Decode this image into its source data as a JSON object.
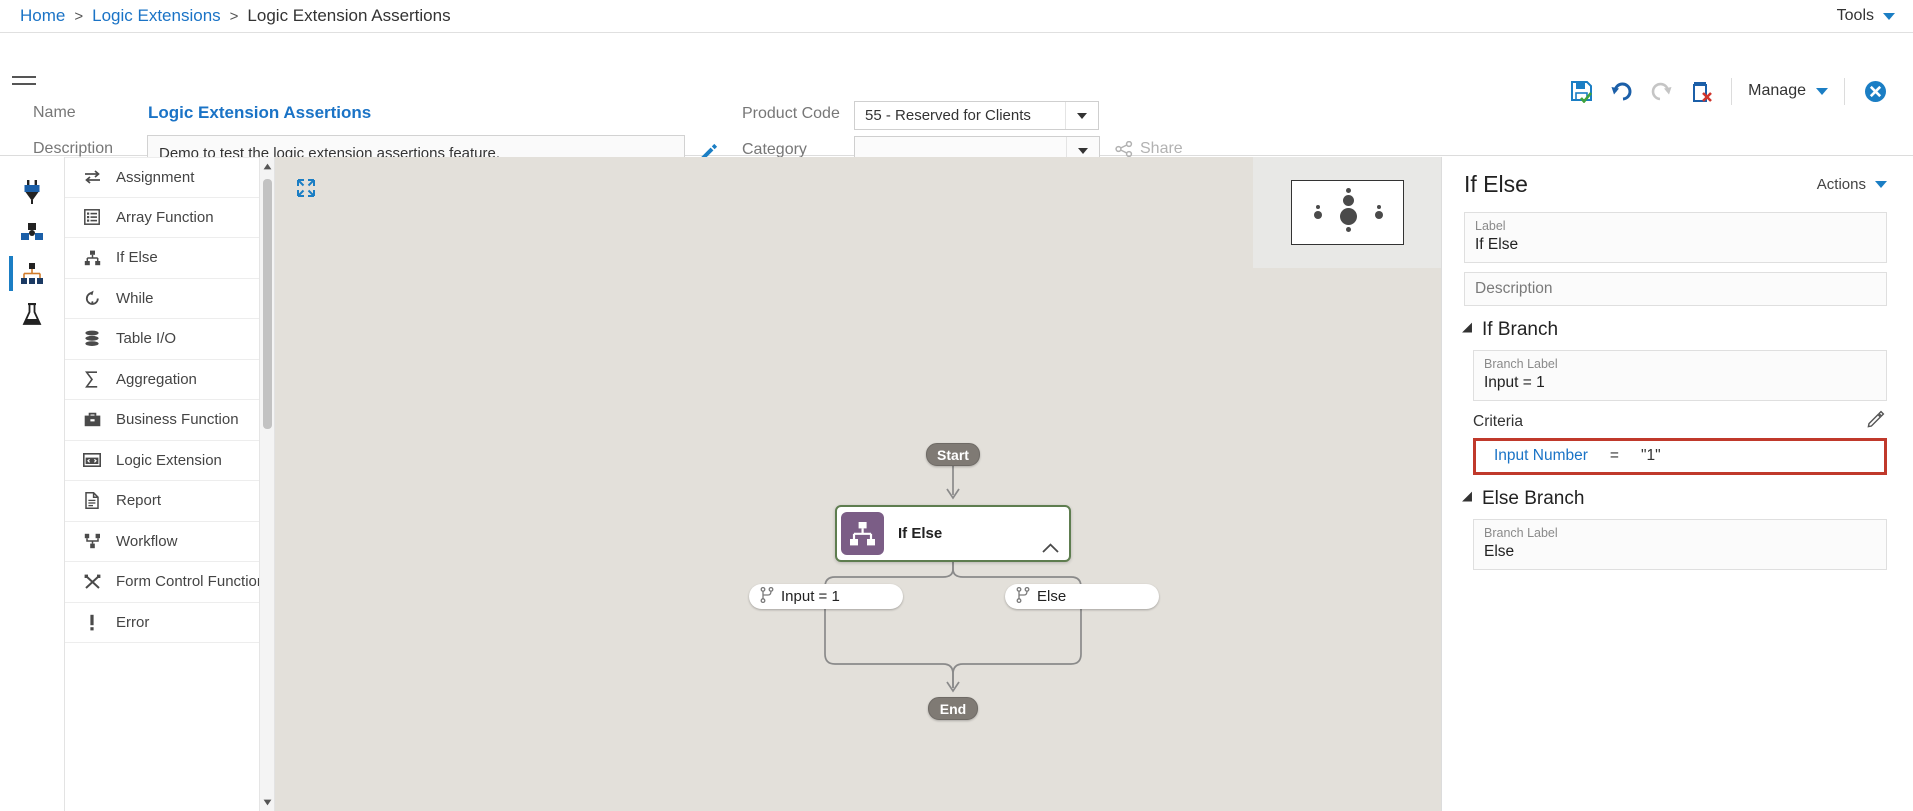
{
  "breadcrumb": {
    "items": [
      {
        "label": "Home",
        "link": true
      },
      {
        "label": "Logic Extensions",
        "link": true
      },
      {
        "label": "Logic Extension Assertions",
        "link": false
      }
    ],
    "separator": ">",
    "tools_label": "Tools"
  },
  "header": {
    "name_label": "Name",
    "name_value": "Logic Extension Assertions",
    "description_label": "Description",
    "description_value": "Demo to test the logic extension assertions feature.",
    "product_code_label": "Product Code",
    "product_code_value": "55 - Reserved for Clients",
    "category_label": "Category",
    "category_value": "",
    "share_label": "Share",
    "manage_label": "Manage",
    "toolbar_icons": [
      "save-icon",
      "undo-icon",
      "redo-icon",
      "delete-icon"
    ],
    "close_icon": "close-icon"
  },
  "rail": {
    "items": [
      {
        "name": "plug-icon",
        "active": false
      },
      {
        "name": "blocks-icon",
        "active": false
      },
      {
        "name": "hierarchy-icon",
        "active": true
      },
      {
        "name": "flask-icon",
        "active": false
      }
    ]
  },
  "palette": {
    "items": [
      {
        "label": "Assignment",
        "icon": "assignment-icon"
      },
      {
        "label": "Array Function",
        "icon": "array-function-icon"
      },
      {
        "label": "If Else",
        "icon": "if-else-icon"
      },
      {
        "label": "While",
        "icon": "while-icon"
      },
      {
        "label": "Table I/O",
        "icon": "table-io-icon"
      },
      {
        "label": "Aggregation",
        "icon": "aggregation-icon"
      },
      {
        "label": "Business Function",
        "icon": "business-function-icon"
      },
      {
        "label": "Logic Extension",
        "icon": "logic-extension-icon"
      },
      {
        "label": "Report",
        "icon": "report-icon"
      },
      {
        "label": "Workflow",
        "icon": "workflow-icon"
      },
      {
        "label": "Form Control Function",
        "icon": "form-control-icon"
      },
      {
        "label": "Error",
        "icon": "error-icon"
      }
    ]
  },
  "canvas": {
    "expand_icon": "expand-icon",
    "start_label": "Start",
    "end_label": "End",
    "node_label": "If Else",
    "node_icon": "if-else-icon",
    "branch_if_label": "Input = 1",
    "branch_else_label": "Else",
    "branch_icon": "branch-fork-icon",
    "background_color": "#e3e0da",
    "node_border_color": "#5e7d4f",
    "node_icon_color": "#7b5d86"
  },
  "properties": {
    "title": "If Else",
    "actions_label": "Actions",
    "label_key": "Label",
    "label_value": "If Else",
    "description_placeholder": "Description",
    "if_branch": {
      "section_title": "If Branch",
      "branch_label_key": "Branch Label",
      "branch_label_value": "Input = 1",
      "criteria_title": "Criteria",
      "criteria_edit_icon": "pencil-icon",
      "criteria_field": "Input Number",
      "criteria_operator": "=",
      "criteria_value": "\"1\"",
      "highlight_color": "#c0392b"
    },
    "else_branch": {
      "section_title": "Else Branch",
      "branch_label_key": "Branch Label",
      "branch_label_value": "Else"
    }
  }
}
